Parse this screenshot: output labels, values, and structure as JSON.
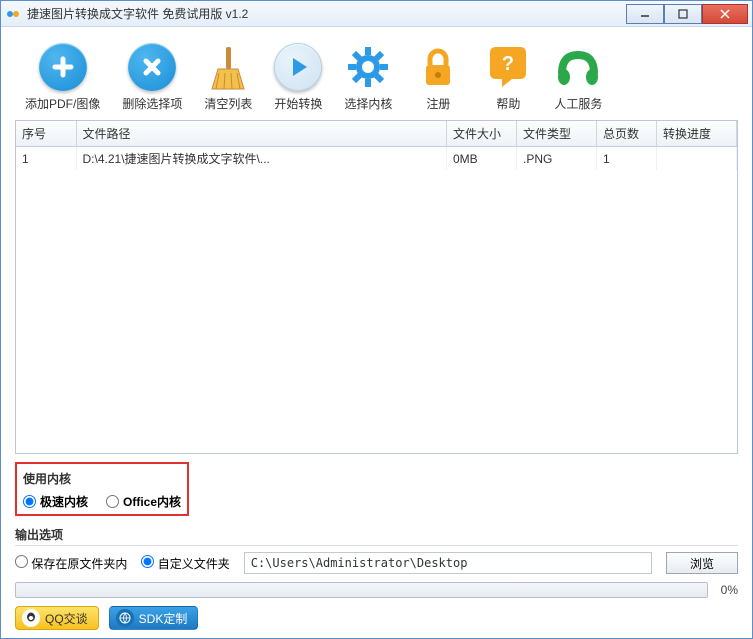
{
  "window": {
    "title": "捷速图片转换成文字软件 免费试用版 v1.2"
  },
  "toolbar": [
    {
      "key": "add",
      "label": "添加PDF/图像"
    },
    {
      "key": "del",
      "label": "删除选择项"
    },
    {
      "key": "clear",
      "label": "清空列表"
    },
    {
      "key": "start",
      "label": "开始转换"
    },
    {
      "key": "kernel",
      "label": "选择内核"
    },
    {
      "key": "register",
      "label": "注册"
    },
    {
      "key": "help",
      "label": "帮助"
    },
    {
      "key": "service",
      "label": "人工服务"
    }
  ],
  "table": {
    "headers": [
      "序号",
      "文件路径",
      "文件大小",
      "文件类型",
      "总页数",
      "转换进度"
    ],
    "rows": [
      {
        "index": "1",
        "path": "D:\\4.21\\捷速图片转换成文字软件\\...",
        "size": "0MB",
        "type": ".PNG",
        "pages": "1",
        "progress": ""
      }
    ]
  },
  "kernel_group": {
    "title": "使用内核",
    "opt1": "极速内核",
    "opt2": "Office内核",
    "selected": "opt1"
  },
  "output_group": {
    "title": "输出选项",
    "opt1": "保存在原文件夹内",
    "opt2": "自定义文件夹",
    "selected": "opt2",
    "path": "C:\\Users\\Administrator\\Desktop",
    "browse": "浏览"
  },
  "progress": {
    "percent": "0%"
  },
  "footer": {
    "qq": "QQ交谈",
    "sdk": "SDK定制"
  }
}
